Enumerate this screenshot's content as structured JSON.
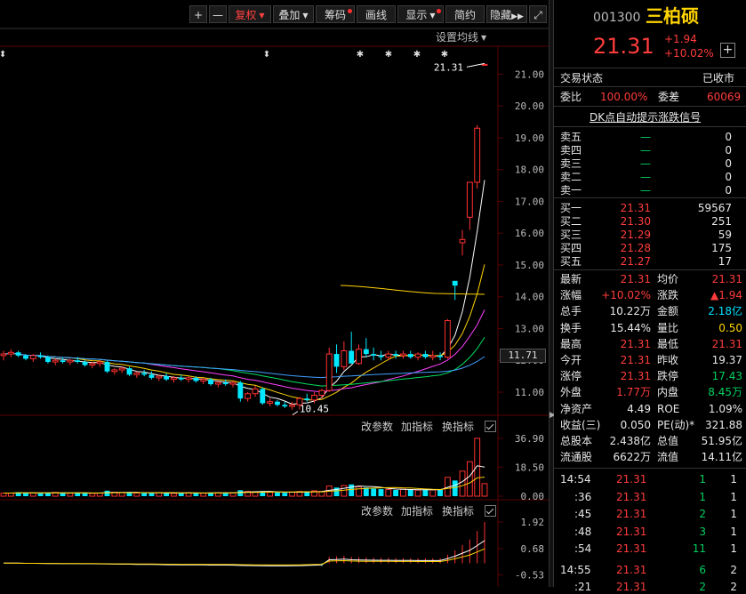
{
  "toolbar": {
    "plus": "+",
    "minus": "—",
    "fuquan": "复权",
    "diejia": "叠加",
    "chouma": "筹码",
    "huaxian": "画线",
    "xianshi": "显示",
    "jianyue": "简约",
    "yincang": "隐藏",
    "fullscreen_icon": "⤢",
    "set_ma": "设置均线"
  },
  "markers": [
    "⬍",
    "⬍",
    "✱",
    "✱",
    "✱",
    "✱"
  ],
  "chart_data": [
    {
      "type": "candlestick",
      "name": "main-kline",
      "ylim": [
        10.3,
        21.6
      ],
      "yticks": [
        "21.00",
        "20.00",
        "19.00",
        "18.00",
        "17.00",
        "16.00",
        "15.00",
        "14.00",
        "13.00",
        "12.00",
        "11.00"
      ],
      "ytick_values": [
        21,
        20,
        19,
        18,
        17,
        16,
        15,
        14,
        13,
        12,
        11
      ],
      "current_price_label": "11.71",
      "annotations": [
        {
          "text": "21.31",
          "x_index": 65,
          "y": 21.31
        },
        {
          "text": "10.45",
          "x_index": 40,
          "y": 10.45
        }
      ],
      "candles": [
        [
          12.15,
          12.3,
          12.0,
          12.2
        ],
        [
          12.2,
          12.35,
          12.1,
          12.25
        ],
        [
          12.25,
          12.3,
          12.1,
          12.15
        ],
        [
          12.15,
          12.2,
          12.0,
          12.05
        ],
        [
          12.05,
          12.2,
          11.95,
          12.15
        ],
        [
          12.15,
          12.25,
          12.05,
          12.1
        ],
        [
          12.1,
          12.15,
          11.9,
          11.95
        ],
        [
          11.95,
          12.05,
          11.85,
          12.0
        ],
        [
          12.0,
          12.1,
          11.9,
          11.95
        ],
        [
          11.95,
          12.05,
          11.85,
          12.0
        ],
        [
          12.0,
          12.1,
          11.9,
          11.95
        ],
        [
          11.95,
          12.0,
          11.8,
          11.85
        ],
        [
          11.85,
          11.95,
          11.75,
          11.9
        ],
        [
          11.9,
          12.0,
          11.8,
          11.95
        ],
        [
          11.95,
          12.0,
          11.6,
          11.65
        ],
        [
          11.65,
          11.75,
          11.55,
          11.7
        ],
        [
          11.7,
          11.8,
          11.6,
          11.75
        ],
        [
          11.75,
          11.8,
          11.5,
          11.55
        ],
        [
          11.55,
          11.65,
          11.45,
          11.6
        ],
        [
          11.6,
          11.7,
          11.5,
          11.55
        ],
        [
          11.55,
          11.65,
          11.4,
          11.45
        ],
        [
          11.45,
          11.55,
          11.35,
          11.5
        ],
        [
          11.5,
          11.6,
          11.35,
          11.4
        ],
        [
          11.4,
          11.5,
          11.3,
          11.45
        ],
        [
          11.45,
          11.55,
          11.35,
          11.4
        ],
        [
          11.4,
          11.5,
          11.3,
          11.45
        ],
        [
          11.45,
          11.5,
          11.3,
          11.35
        ],
        [
          11.35,
          11.45,
          11.25,
          11.4
        ],
        [
          11.4,
          11.45,
          11.2,
          11.25
        ],
        [
          11.25,
          11.35,
          11.15,
          11.3
        ],
        [
          11.3,
          11.4,
          11.2,
          11.25
        ],
        [
          11.25,
          11.35,
          11.15,
          11.3
        ],
        [
          11.3,
          11.35,
          10.7,
          10.8
        ],
        [
          10.8,
          11.0,
          10.7,
          10.95
        ],
        [
          10.95,
          11.2,
          10.85,
          11.1
        ],
        [
          11.1,
          11.15,
          10.6,
          10.65
        ],
        [
          10.65,
          10.8,
          10.55,
          10.7
        ],
        [
          10.7,
          10.75,
          10.55,
          10.6
        ],
        [
          10.6,
          10.7,
          10.5,
          10.55
        ],
        [
          10.55,
          10.7,
          10.45,
          10.6
        ],
        [
          10.6,
          10.85,
          10.45,
          10.8
        ],
        [
          10.8,
          10.95,
          10.7,
          10.75
        ],
        [
          10.75,
          11.0,
          10.65,
          10.9
        ],
        [
          10.9,
          11.1,
          10.8,
          11.05
        ],
        [
          11.05,
          12.4,
          11.0,
          12.2
        ],
        [
          12.2,
          12.5,
          11.6,
          11.8
        ],
        [
          11.8,
          12.6,
          11.7,
          12.3
        ],
        [
          12.3,
          12.9,
          12.0,
          11.9
        ],
        [
          11.9,
          12.5,
          11.85,
          12.35
        ],
        [
          12.35,
          12.7,
          12.1,
          12.2
        ],
        [
          12.2,
          12.4,
          12.0,
          12.15
        ],
        [
          12.15,
          12.3,
          12.0,
          12.1
        ],
        [
          12.1,
          12.3,
          12.0,
          12.2
        ],
        [
          12.2,
          12.3,
          12.05,
          12.15
        ],
        [
          12.15,
          12.3,
          12.05,
          12.2
        ],
        [
          12.2,
          12.3,
          12.05,
          12.1
        ],
        [
          12.1,
          12.25,
          12.0,
          12.2
        ],
        [
          12.2,
          12.3,
          12.05,
          12.1
        ],
        [
          12.1,
          12.3,
          12.0,
          12.15
        ],
        [
          12.15,
          12.25,
          12.0,
          12.1
        ],
        [
          12.1,
          13.3,
          12.05,
          13.25
        ],
        [
          14.5,
          14.5,
          13.9,
          14.35
        ],
        [
          15.7,
          16.1,
          15.3,
          15.8
        ],
        [
          16.5,
          17.6,
          16.1,
          17.6
        ],
        [
          17.6,
          19.4,
          17.4,
          19.3
        ],
        [
          21.31,
          21.31,
          21.31,
          21.31
        ]
      ]
    },
    {
      "type": "bar",
      "name": "volume",
      "ylim": [
        0,
        38
      ],
      "yticks": [
        "36.90",
        "18.50",
        "0.00"
      ],
      "ytick_values": [
        36.9,
        18.5,
        0
      ],
      "values": [
        2,
        2,
        2.5,
        2,
        2.2,
        1.8,
        2,
        2.4,
        2,
        1.9,
        2.1,
        2.2,
        1.8,
        2,
        3.5,
        2.5,
        2.2,
        2.4,
        2,
        2.1,
        1.9,
        2.3,
        2,
        1.8,
        2.2,
        2.1,
        2,
        1.9,
        2.3,
        2.2,
        2.4,
        2.1,
        3.8,
        3,
        2.8,
        3.2,
        2.5,
        2.4,
        2.2,
        2.6,
        3,
        2.8,
        3.4,
        3,
        6.5,
        5.5,
        6.8,
        7.5,
        6,
        5.5,
        4.8,
        4.5,
        4.2,
        4,
        4.5,
        4.1,
        3.9,
        4.2,
        4,
        4.3,
        12,
        10,
        16,
        22,
        36.9,
        8
      ]
    },
    {
      "type": "bar",
      "name": "indicator",
      "ylim": [
        -0.6,
        2.0
      ],
      "yticks": [
        "1.92",
        "0.68",
        "-0.53"
      ],
      "ytick_values": [
        1.92,
        0.68,
        -0.53
      ],
      "values": [
        0.02,
        0.02,
        0.01,
        0,
        0,
        -0.01,
        -0.02,
        -0.02,
        -0.03,
        -0.03,
        -0.03,
        -0.04,
        -0.04,
        -0.05,
        -0.06,
        -0.07,
        -0.08,
        -0.08,
        -0.09,
        -0.1,
        -0.1,
        -0.11,
        -0.12,
        -0.12,
        -0.13,
        -0.13,
        -0.14,
        -0.14,
        -0.15,
        -0.15,
        -0.15,
        -0.16,
        -0.18,
        -0.19,
        -0.2,
        -0.21,
        -0.22,
        -0.22,
        -0.22,
        -0.21,
        -0.2,
        -0.18,
        -0.16,
        -0.13,
        0.3,
        0.32,
        0.35,
        0.3,
        0.28,
        0.27,
        0.26,
        0.25,
        0.25,
        0.24,
        0.24,
        0.24,
        0.23,
        0.23,
        0.23,
        0.23,
        0.4,
        0.6,
        0.85,
        1.1,
        1.5,
        1.92
      ]
    }
  ],
  "vol_panel": {
    "change_params": "改参数",
    "add_indicator": "加指标",
    "switch_indicator": "换指标"
  },
  "ind_panel": {
    "change_params": "改参数",
    "add_indicator": "加指标",
    "switch_indicator": "换指标"
  },
  "quote": {
    "code": "001300",
    "name": "三柏硕",
    "price": "21.31",
    "change": "+1.94",
    "pct": "+10.02%",
    "add": "+",
    "trade_status_label": "交易状态",
    "trade_status": "已收市",
    "weibi_label": "委比",
    "weibi": "100.00%",
    "weicha_label": "委差",
    "weicha": "60069",
    "dk_link": "DK点自动提示涨跌信号",
    "sell": [
      {
        "label": "卖五",
        "price": "—",
        "vol": "0"
      },
      {
        "label": "卖四",
        "price": "—",
        "vol": "0"
      },
      {
        "label": "卖三",
        "price": "—",
        "vol": "0"
      },
      {
        "label": "卖二",
        "price": "—",
        "vol": "0"
      },
      {
        "label": "卖一",
        "price": "—",
        "vol": "0"
      }
    ],
    "buy": [
      {
        "label": "买一",
        "price": "21.31",
        "vol": "59567"
      },
      {
        "label": "买二",
        "price": "21.30",
        "vol": "251"
      },
      {
        "label": "买三",
        "price": "21.29",
        "vol": "59"
      },
      {
        "label": "买四",
        "price": "21.28",
        "vol": "175"
      },
      {
        "label": "买五",
        "price": "21.27",
        "vol": "17"
      }
    ],
    "stats": [
      {
        "l1": "最新",
        "v1": "21.31",
        "c1": "red",
        "l2": "均价",
        "v2": "21.31",
        "c2": "red"
      },
      {
        "l1": "涨幅",
        "v1": "+10.02%",
        "c1": "red",
        "l2": "涨跌",
        "v2": "▲1.94",
        "c2": "red"
      },
      {
        "l1": "总手",
        "v1": "10.22万",
        "c1": "white",
        "l2": "金额",
        "v2": "2.18亿",
        "c2": "cyan"
      },
      {
        "l1": "换手",
        "v1": "15.44%",
        "c1": "white",
        "l2": "量比",
        "v2": "0.50",
        "c2": "yellow"
      },
      {
        "l1": "最高",
        "v1": "21.31",
        "c1": "red",
        "l2": "最低",
        "v2": "21.31",
        "c2": "red"
      },
      {
        "l1": "今开",
        "v1": "21.31",
        "c1": "red",
        "l2": "昨收",
        "v2": "19.37",
        "c2": "white"
      },
      {
        "l1": "涨停",
        "v1": "21.31",
        "c1": "red",
        "l2": "跌停",
        "v2": "17.43",
        "c2": "green"
      },
      {
        "l1": "外盘",
        "v1": "1.77万",
        "c1": "red",
        "l2": "内盘",
        "v2": "8.45万",
        "c2": "green"
      },
      {
        "l1": "净资产",
        "v1": "4.49",
        "c1": "white",
        "l2": "ROE",
        "v2": "1.09%",
        "c2": "white"
      },
      {
        "l1": "收益(三)",
        "v1": "0.050",
        "c1": "white",
        "l2": "PE(动)*",
        "v2": "321.88",
        "c2": "white"
      },
      {
        "l1": "总股本",
        "v1": "2.438亿",
        "c1": "white",
        "l2": "总值",
        "v2": "51.95亿",
        "c2": "white"
      },
      {
        "l1": "流通股",
        "v1": "6622万",
        "c1": "white",
        "l2": "流值",
        "v2": "14.11亿",
        "c2": "white"
      }
    ],
    "ticks": [
      {
        "time": "14:54",
        "price": "21.31",
        "vol": "1",
        "n": "1",
        "vc": "green"
      },
      {
        "time": ":36",
        "price": "21.31",
        "vol": "1",
        "n": "1",
        "vc": "green"
      },
      {
        "time": ":45",
        "price": "21.31",
        "vol": "2",
        "n": "1",
        "vc": "green"
      },
      {
        "time": ":48",
        "price": "21.31",
        "vol": "3",
        "n": "1",
        "vc": "green"
      },
      {
        "time": ":54",
        "price": "21.31",
        "vol": "11",
        "n": "1",
        "vc": "green"
      },
      {
        "time": "14:55",
        "price": "21.31",
        "vol": "6",
        "n": "2",
        "vc": "green"
      },
      {
        "time": ":21",
        "price": "21.31",
        "vol": "2",
        "n": "2",
        "vc": "green"
      }
    ]
  },
  "colors": {
    "up": "#ff3030",
    "down": "#00e8ff",
    "grid": "#3a0000",
    "axis": "#5a0000"
  }
}
